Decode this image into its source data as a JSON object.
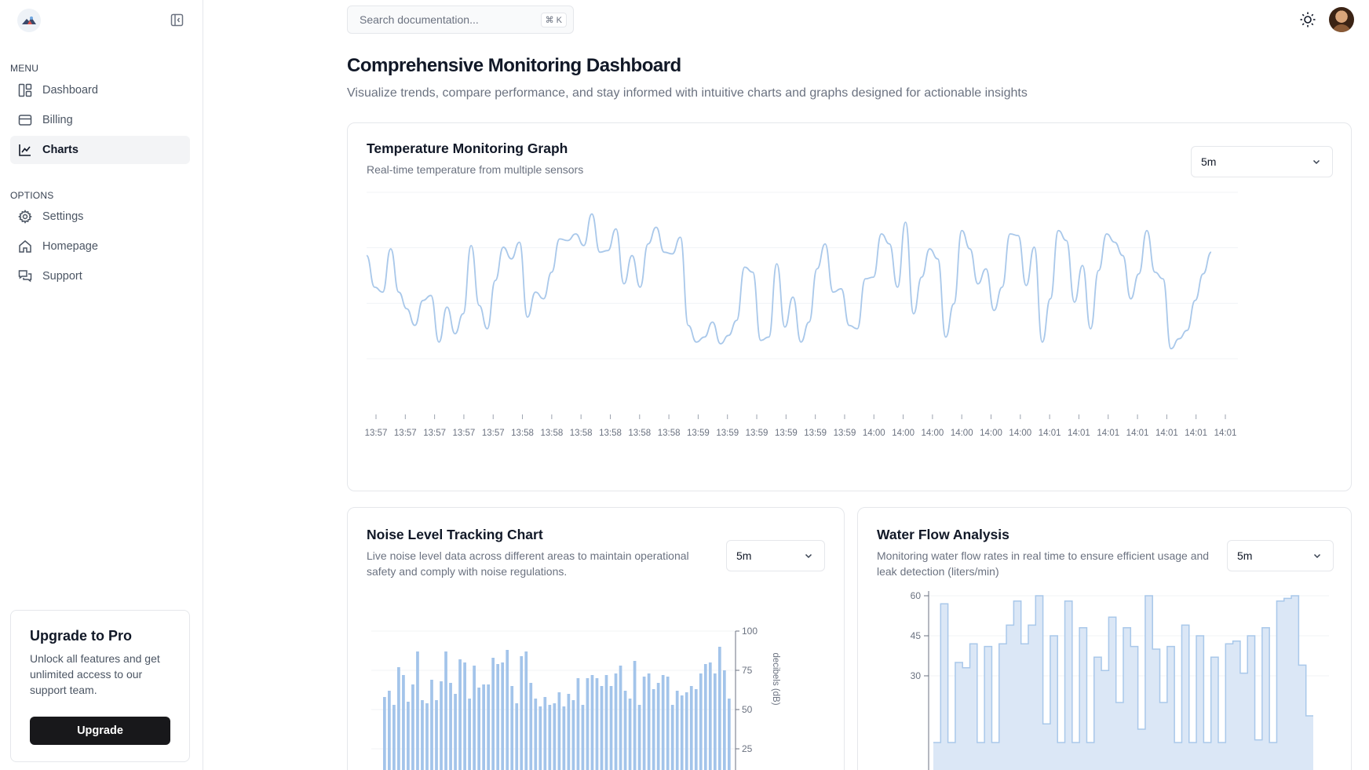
{
  "sidebar": {
    "menu_label": "MENU",
    "options_label": "OPTIONS",
    "menu_items": [
      {
        "label": "Dashboard",
        "icon": "dashboard-icon"
      },
      {
        "label": "Billing",
        "icon": "credit-card-icon"
      },
      {
        "label": "Charts",
        "icon": "line-chart-icon",
        "active": true
      }
    ],
    "option_items": [
      {
        "label": "Settings",
        "icon": "gear-icon"
      },
      {
        "label": "Homepage",
        "icon": "home-icon"
      },
      {
        "label": "Support",
        "icon": "support-chat-icon"
      }
    ],
    "upgrade": {
      "title": "Upgrade to Pro",
      "description": "Unlock all features and get unlimited access to our support team.",
      "button": "Upgrade"
    }
  },
  "header": {
    "search_placeholder": "Search documentation...",
    "shortcut": "⌘ K",
    "theme_icon": "sun-icon"
  },
  "page": {
    "title": "Comprehensive Monitoring Dashboard",
    "subtitle": "Visualize trends, compare performance, and stay informed with intuitive charts and graphs designed for actionable insights"
  },
  "temperature_card": {
    "title": "Temperature Monitoring Graph",
    "description": "Real-time temperature from multiple sensors",
    "range": "5m"
  },
  "noise_card": {
    "title": "Noise Level Tracking Chart",
    "description": "Live noise level data across different areas to maintain operational safety and comply with noise regulations.",
    "range": "5m"
  },
  "water_card": {
    "title": "Water Flow Analysis",
    "description": "Monitoring water flow rates in real time to ensure efficient usage and leak detection (liters/min)",
    "range": "5m"
  },
  "colors": {
    "line": "#a9c8ea",
    "bar": "#a3c4ea",
    "area_fill": "#dbe7f6",
    "area_stroke": "#a9c8ea"
  },
  "chart_data": [
    {
      "type": "line",
      "x": [
        "13:57",
        "13:57",
        "13:57",
        "13:57",
        "13:57",
        "13:58",
        "13:58",
        "13:58",
        "13:58",
        "13:58",
        "13:58",
        "13:59",
        "13:59",
        "13:59",
        "13:59",
        "13:59",
        "13:59",
        "14:00",
        "14:00",
        "14:00",
        "14:00",
        "14:00",
        "14:00",
        "14:01",
        "14:01",
        "14:01",
        "14:01",
        "14:01",
        "14:01",
        "14:01"
      ],
      "values": [
        62,
        43,
        40,
        66,
        40,
        30,
        20,
        35,
        38,
        10,
        31,
        15,
        27,
        68,
        32,
        18,
        47,
        67,
        60,
        70,
        25,
        40,
        36,
        52,
        72,
        71,
        75,
        68,
        87,
        64,
        65,
        78,
        45,
        62,
        43,
        69,
        79,
        64,
        63,
        73,
        20,
        10,
        13,
        22,
        9,
        14,
        23,
        55,
        52,
        11,
        13,
        57,
        19,
        37,
        10,
        22,
        54,
        69,
        40,
        42,
        20,
        18,
        48,
        49,
        75,
        69,
        43,
        82,
        27,
        49,
        66,
        60,
        13,
        33,
        77,
        66,
        45,
        54,
        29,
        43,
        75,
        74,
        44,
        67,
        10,
        36,
        77,
        71,
        34,
        56,
        18,
        53,
        75,
        70,
        62,
        36,
        51,
        77,
        52,
        48,
        6,
        12,
        17,
        35,
        51,
        64
      ],
      "ylim": [
        0,
        100
      ],
      "grid": true
    },
    {
      "type": "bar",
      "values": [
        58,
        62,
        53,
        77,
        72,
        55,
        66,
        87,
        56,
        54,
        69,
        56,
        68,
        87,
        67,
        60,
        82,
        80,
        57,
        78,
        64,
        66,
        66,
        83,
        79,
        80,
        88,
        65,
        54,
        84,
        87,
        67,
        57,
        52,
        58,
        53,
        54,
        61,
        52,
        60,
        56,
        70,
        53,
        70,
        72,
        70,
        65,
        72,
        65,
        73,
        78,
        62,
        57,
        81,
        53,
        71,
        73,
        63,
        67,
        72,
        71,
        53,
        62,
        59,
        61,
        65,
        63,
        73,
        79,
        80,
        73,
        90,
        75,
        57
      ],
      "ylabel": "decibels (dB)",
      "yticks": [
        25,
        50,
        75,
        100
      ],
      "ylim": [
        0,
        100
      ],
      "grid": true
    },
    {
      "type": "area",
      "values": [
        5,
        57,
        5,
        35,
        33,
        42,
        5,
        41,
        5,
        42,
        49,
        58,
        42,
        49,
        60,
        12,
        45,
        5,
        58,
        5,
        48,
        5,
        37,
        32,
        52,
        20,
        48,
        41,
        10,
        60,
        40,
        20,
        41,
        5,
        49,
        5,
        45,
        5,
        37,
        5,
        42,
        43,
        31,
        45,
        6,
        48,
        5,
        58,
        59,
        60,
        34,
        15
      ],
      "yticks": [
        30,
        45,
        60
      ],
      "ylim": [
        0,
        60
      ],
      "grid": true
    }
  ]
}
